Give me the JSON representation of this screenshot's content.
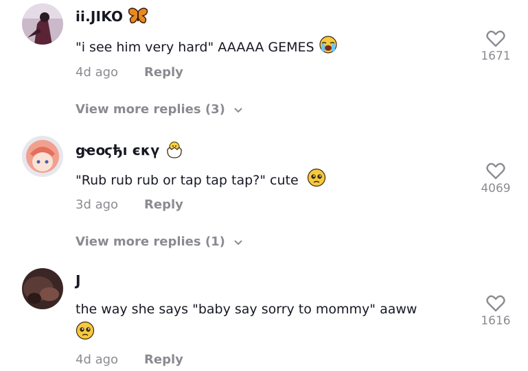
{
  "comments": [
    {
      "username": "ii.JIKO",
      "username_emoji": "butterfly",
      "text": "\"i see him very hard\" AAAAA GEMES",
      "text_emoji": "loudly-crying-face",
      "time": "4d ago",
      "reply_label": "Reply",
      "likes": "1671",
      "more_replies": "View more replies (3)"
    },
    {
      "username": "ցҽօϛђı єκү",
      "username_emoji": "hatching-chick",
      "text": "\"Rub rub rub or tap tap tap?\" cute",
      "text_emoji": "pleading-face",
      "time": "3d ago",
      "reply_label": "Reply",
      "likes": "4069",
      "more_replies": "View more replies (1)"
    },
    {
      "username": "J",
      "text": "the way she says \"baby say sorry to mommy\" aaww",
      "text_emoji": "pleading-face",
      "time": "4d ago",
      "reply_label": "Reply",
      "likes": "1616"
    }
  ],
  "colors": {
    "text": "#161823",
    "muted": "#8a8b91"
  }
}
